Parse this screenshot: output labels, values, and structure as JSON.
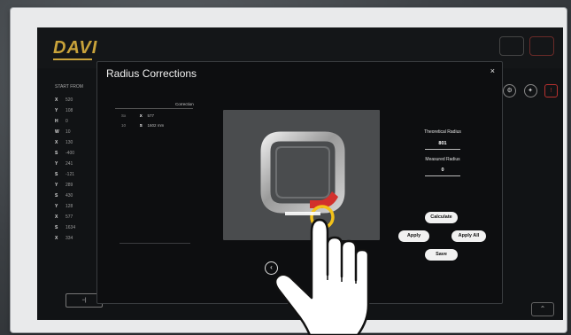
{
  "app": {
    "logo": "DAVI",
    "left_panel": {
      "header": "START FROM",
      "rows": [
        {
          "axis": "X",
          "value": "520"
        },
        {
          "axis": "Y",
          "value": "108"
        },
        {
          "axis": "H",
          "value": "0"
        },
        {
          "axis": "W",
          "value": "10"
        },
        {
          "axis": "X",
          "value": "130"
        },
        {
          "axis": "S",
          "value": "-400"
        },
        {
          "axis": "Y",
          "value": "241"
        },
        {
          "axis": "S",
          "value": "-121"
        },
        {
          "axis": "Y",
          "value": "289"
        },
        {
          "axis": "S",
          "value": "430"
        },
        {
          "axis": "Y",
          "value": "128"
        },
        {
          "axis": "X",
          "value": "577"
        },
        {
          "axis": "S",
          "value": "1634"
        },
        {
          "axis": "X",
          "value": "334"
        }
      ]
    }
  },
  "modal": {
    "title": "Radius Corrections",
    "close": "×",
    "correction_header": "Correction",
    "corrections": [
      {
        "index": "Sx",
        "symbol": "X",
        "value": "577"
      },
      {
        "index": "10",
        "symbol": "S",
        "value": "1602",
        "unit": "mm"
      }
    ],
    "theoretical_radius_label": "Theoretical Radius",
    "theoretical_radius_value": "801",
    "measured_radius_label": "Measured Radius",
    "measured_radius_value": "0",
    "buttons": {
      "calculate": "Calculate",
      "apply": "Apply",
      "apply_all": "Apply All",
      "save": "Save"
    },
    "prev_icon": "‹"
  },
  "colors": {
    "accent_gold": "#c9a33a",
    "highlight_red": "#d2302c",
    "touch_ring_yellow": "#f3c21a"
  }
}
